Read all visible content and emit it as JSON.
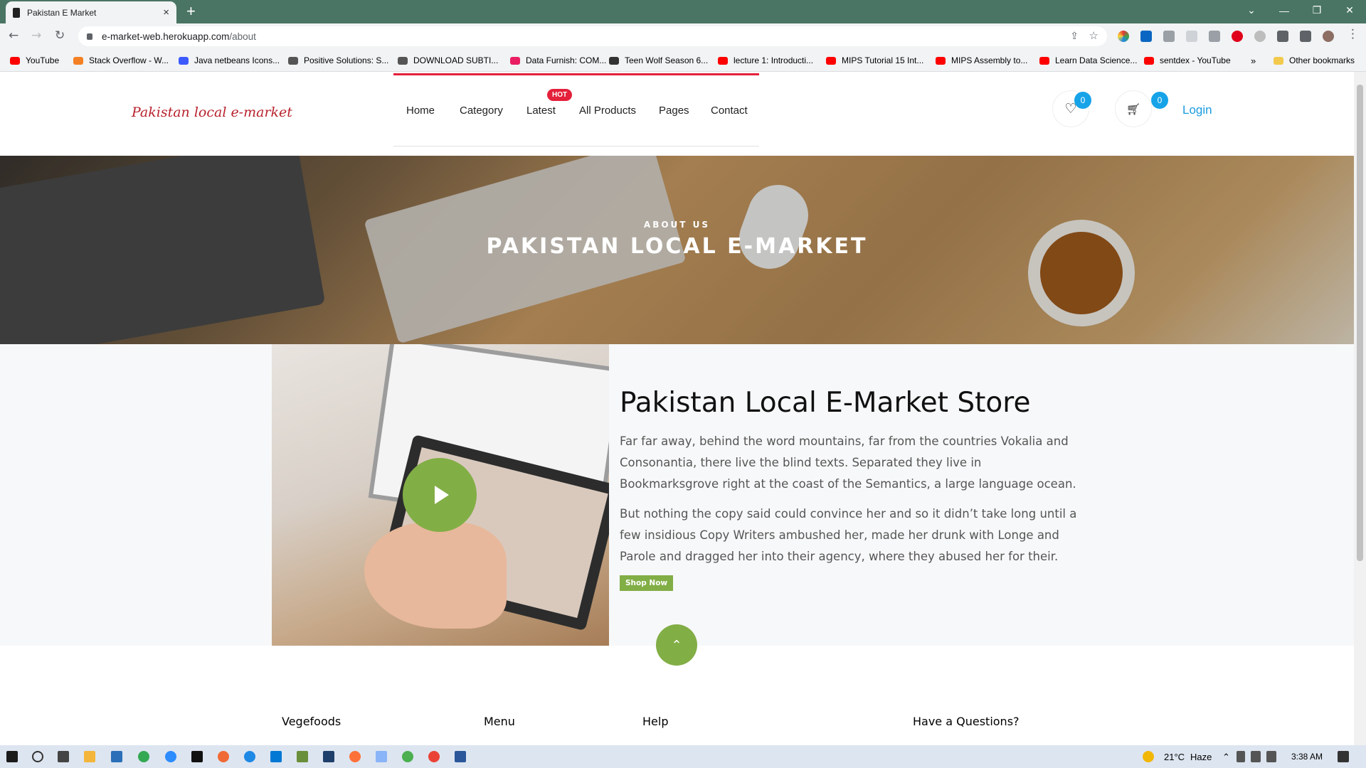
{
  "browser": {
    "tab_title": "Pakistan E Market",
    "url_host": "e-market-web.herokuapp.com",
    "url_path": "/about",
    "new_tab": "+",
    "close_tab": "×",
    "bookmarks": [
      {
        "label": "YouTube",
        "color": "#ff0000"
      },
      {
        "label": "Stack Overflow - W...",
        "color": "#f48024"
      },
      {
        "label": "Java netbeans Icons...",
        "color": "#3d5afe"
      },
      {
        "label": "Positive Solutions: S...",
        "color": "#555555"
      },
      {
        "label": "DOWNLOAD SUBTI...",
        "color": "#555555"
      },
      {
        "label": "Data Furnish: COM...",
        "color": "#e91e63"
      },
      {
        "label": "Teen Wolf Season 6...",
        "color": "#333333"
      },
      {
        "label": "lecture 1: Introducti...",
        "color": "#ff0000"
      },
      {
        "label": "MIPS Tutorial 15 Int...",
        "color": "#ff0000"
      },
      {
        "label": "MIPS Assembly to...",
        "color": "#ff0000"
      },
      {
        "label": "Learn Data Science...",
        "color": "#ff0000"
      },
      {
        "label": "sentdex - YouTube",
        "color": "#ff0000"
      }
    ],
    "more_bookmarks": "»",
    "other_bookmarks": "Other bookmarks"
  },
  "site": {
    "logo": "Pakistan local e-market",
    "nav": [
      "Home",
      "Category",
      "Latest",
      "All Products",
      "Pages",
      "Contact"
    ],
    "hot_badge": "HOT",
    "wishlist_count": "0",
    "cart_count": "0",
    "login": "Login",
    "accent_color": "#82ae46"
  },
  "hero": {
    "subtitle": "ABOUT US",
    "title": "PAKISTAN LOCAL E-MARKET"
  },
  "about": {
    "title": "Pakistan Local E-Market Store",
    "paragraph1": "Far far away, behind the word mountains, far from the countries Vokalia and Consonantia, there live the blind texts. Separated they live in Bookmarksgrove right at the coast of the Semantics, a large language ocean.",
    "paragraph2": "But nothing the copy said could convince her and so it didn’t take long until a few insidious Copy Writers ambushed her, made her drunk with Longe and Parole and dragged her into their agency, where they abused her for their.",
    "button": "Shop Now"
  },
  "footer": {
    "headings": [
      "Vegefoods",
      "Menu",
      "Help",
      "Have a Questions?"
    ]
  },
  "taskbar": {
    "temperature": "21°C",
    "weather": "Haze",
    "time": "3:38 AM"
  }
}
